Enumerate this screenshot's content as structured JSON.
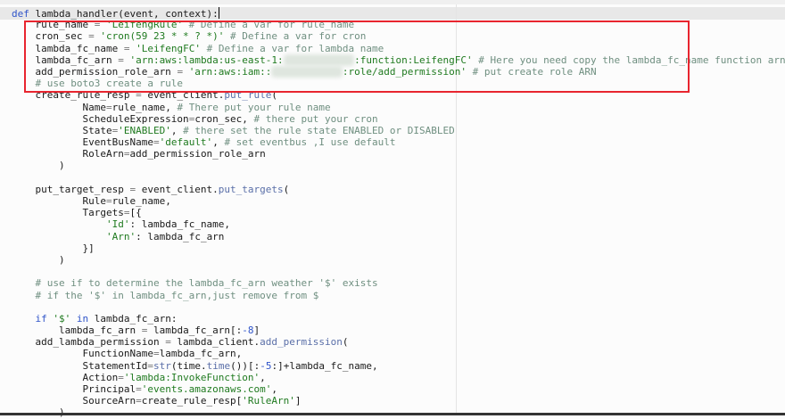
{
  "editor": {
    "language": "python",
    "highlight_color": "#e8252f",
    "lines": [
      [
        [
          "k",
          "def"
        ],
        [
          "p",
          " lambda_handler(event, context):"
        ]
      ],
      [
        [
          "p",
          "    rule_name "
        ],
        [
          "o",
          "="
        ],
        [
          "p",
          " "
        ],
        [
          "s",
          "'LeifengRule'"
        ],
        [
          "c",
          " # Define a var for rule_name"
        ]
      ],
      [
        [
          "p",
          "    cron_sec "
        ],
        [
          "o",
          "="
        ],
        [
          "p",
          " "
        ],
        [
          "s",
          "'cron(59 23 * * ? *)'"
        ],
        [
          "c",
          " # Define a var for cron"
        ]
      ],
      [
        [
          "p",
          "    lambda_fc_name "
        ],
        [
          "o",
          "="
        ],
        [
          "p",
          " "
        ],
        [
          "s",
          "'LeifengFC'"
        ],
        [
          "c",
          " # Define a var for lambda name"
        ]
      ],
      [
        [
          "p",
          "    lambda_fc_arn "
        ],
        [
          "o",
          "="
        ],
        [
          "p",
          " "
        ],
        [
          "s",
          "'arn:aws:lambda:us-east-1:"
        ],
        [
          "r",
          "            "
        ],
        [
          "s",
          ":function:LeifengFC'"
        ],
        [
          "c",
          " # Here you need copy the lambda_fc_name function arn"
        ]
      ],
      [
        [
          "p",
          "    add_permission_role_arn "
        ],
        [
          "o",
          "="
        ],
        [
          "p",
          " "
        ],
        [
          "s",
          "'arn:aws:iam::"
        ],
        [
          "r",
          "            "
        ],
        [
          "s",
          ":role/add_permission'"
        ],
        [
          "c",
          " # put create role ARN"
        ]
      ],
      [
        [
          "c",
          "    # use boto3 create a rule"
        ]
      ],
      [
        [
          "p",
          "    create_rule_resp "
        ],
        [
          "o",
          "="
        ],
        [
          "p",
          " event_client."
        ],
        [
          "f",
          "put_rule"
        ],
        [
          "p",
          "("
        ]
      ],
      [
        [
          "p",
          "            Name"
        ],
        [
          "o",
          "="
        ],
        [
          "p",
          "rule_name, "
        ],
        [
          "c",
          "# There put your rule name"
        ]
      ],
      [
        [
          "p",
          "            ScheduleExpression"
        ],
        [
          "o",
          "="
        ],
        [
          "p",
          "cron_sec, "
        ],
        [
          "c",
          "# there put your cron"
        ]
      ],
      [
        [
          "p",
          "            State"
        ],
        [
          "o",
          "="
        ],
        [
          "s",
          "'ENABLED'"
        ],
        [
          "p",
          ", "
        ],
        [
          "c",
          "# there set the rule state ENABLED or DISABLED"
        ]
      ],
      [
        [
          "p",
          "            EventBusName"
        ],
        [
          "o",
          "="
        ],
        [
          "s",
          "'default'"
        ],
        [
          "p",
          ", "
        ],
        [
          "c",
          "# set eventbus ,I use default"
        ]
      ],
      [
        [
          "p",
          "            RoleArn"
        ],
        [
          "o",
          "="
        ],
        [
          "p",
          "add_permission_role_arn"
        ]
      ],
      [
        [
          "p",
          "        )"
        ]
      ],
      [],
      [
        [
          "p",
          "    put_target_resp "
        ],
        [
          "o",
          "="
        ],
        [
          "p",
          " event_client."
        ],
        [
          "f",
          "put_targets"
        ],
        [
          "p",
          "("
        ]
      ],
      [
        [
          "p",
          "            Rule"
        ],
        [
          "o",
          "="
        ],
        [
          "p",
          "rule_name,"
        ]
      ],
      [
        [
          "p",
          "            Targets"
        ],
        [
          "o",
          "="
        ],
        [
          "p",
          "[{"
        ]
      ],
      [
        [
          "p",
          "                "
        ],
        [
          "s",
          "'Id'"
        ],
        [
          "p",
          ": lambda_fc_name,"
        ]
      ],
      [
        [
          "p",
          "                "
        ],
        [
          "s",
          "'Arn'"
        ],
        [
          "p",
          ": lambda_fc_arn"
        ]
      ],
      [
        [
          "p",
          "            }]"
        ]
      ],
      [
        [
          "p",
          "        )"
        ]
      ],
      [],
      [
        [
          "c",
          "    # use if to determine the lambda_fc_arn weather '$' exists"
        ]
      ],
      [
        [
          "c",
          "    # if the '$' in lambda_fc_arn,just remove from $"
        ]
      ],
      [],
      [
        [
          "p",
          "    "
        ],
        [
          "k",
          "if"
        ],
        [
          "p",
          " "
        ],
        [
          "s",
          "'$'"
        ],
        [
          "p",
          " "
        ],
        [
          "k",
          "in"
        ],
        [
          "p",
          " lambda_fc_arn:"
        ]
      ],
      [
        [
          "p",
          "        lambda_fc_arn "
        ],
        [
          "o",
          "="
        ],
        [
          "p",
          " lambda_fc_arn[:"
        ],
        [
          "n",
          "-8"
        ],
        [
          "p",
          "]"
        ]
      ],
      [
        [
          "p",
          "    add_lambda_permission "
        ],
        [
          "o",
          "="
        ],
        [
          "p",
          " lambda_client."
        ],
        [
          "f",
          "add_permission"
        ],
        [
          "p",
          "("
        ]
      ],
      [
        [
          "p",
          "            FunctionName"
        ],
        [
          "o",
          "="
        ],
        [
          "p",
          "lambda_fc_arn,"
        ]
      ],
      [
        [
          "p",
          "            StatementId"
        ],
        [
          "o",
          "="
        ],
        [
          "f",
          "str"
        ],
        [
          "p",
          "(time."
        ],
        [
          "f",
          "time"
        ],
        [
          "p",
          "())[:"
        ],
        [
          "n",
          "-5"
        ],
        [
          "p",
          ":]+lambda_fc_name,"
        ]
      ],
      [
        [
          "p",
          "            Action"
        ],
        [
          "o",
          "="
        ],
        [
          "s",
          "'lambda:InvokeFunction'"
        ],
        [
          "p",
          ","
        ]
      ],
      [
        [
          "p",
          "            Principal"
        ],
        [
          "o",
          "="
        ],
        [
          "s",
          "'events.amazonaws.com'"
        ],
        [
          "p",
          ","
        ]
      ],
      [
        [
          "p",
          "            SourceArn"
        ],
        [
          "o",
          "="
        ],
        [
          "p",
          "create_rule_resp["
        ],
        [
          "s",
          "'RuleArn'"
        ],
        [
          "p",
          "]"
        ]
      ],
      [
        [
          "p",
          "        )"
        ]
      ]
    ]
  }
}
